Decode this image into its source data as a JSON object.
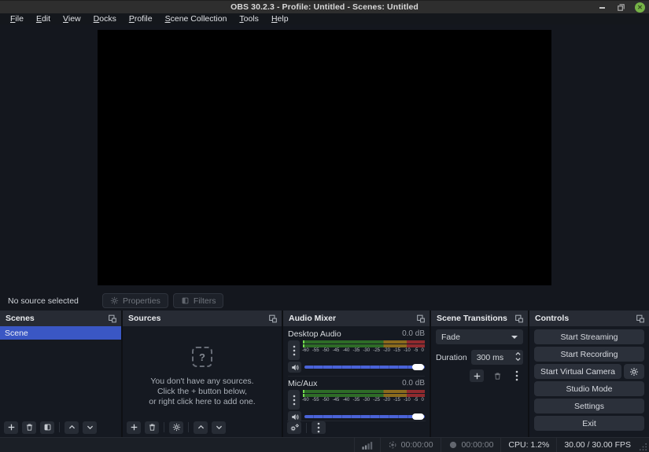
{
  "titlebar": {
    "title": "OBS 30.2.3 - Profile: Untitled - Scenes: Untitled"
  },
  "menubar": {
    "items": [
      "File",
      "Edit",
      "View",
      "Docks",
      "Profile",
      "Scene Collection",
      "Tools",
      "Help"
    ]
  },
  "source_toolbar": {
    "status": "No source selected",
    "properties": "Properties",
    "filters": "Filters"
  },
  "scenes": {
    "title": "Scenes",
    "items": [
      {
        "label": "Scene"
      }
    ]
  },
  "sources": {
    "title": "Sources",
    "empty_icon": "?",
    "empty_lines": [
      "You don't have any sources.",
      "Click the + button below,",
      "or right click here to add one."
    ]
  },
  "audio_mixer": {
    "title": "Audio Mixer",
    "channels": [
      {
        "name": "Desktop Audio",
        "level": "0.0 dB"
      },
      {
        "name": "Mic/Aux",
        "level": "0.0 dB"
      }
    ],
    "ticks": [
      "-60",
      "-55",
      "-50",
      "-45",
      "-40",
      "-35",
      "-30",
      "-25",
      "-20",
      "-15",
      "-10",
      "-5",
      "0"
    ]
  },
  "transitions": {
    "title": "Scene Transitions",
    "selected": "Fade",
    "duration_label": "Duration",
    "duration_value": "300 ms"
  },
  "controls": {
    "title": "Controls",
    "start_streaming": "Start Streaming",
    "start_recording": "Start Recording",
    "start_virtual_camera": "Start Virtual Camera",
    "studio_mode": "Studio Mode",
    "settings": "Settings",
    "exit": "Exit"
  },
  "statusbar": {
    "stream_time": "00:00:00",
    "record_time": "00:00:00",
    "cpu": "CPU: 1.2%",
    "fps": "30.00 / 30.00 FPS"
  },
  "colors": {
    "selection_blue": "#3a57c4",
    "slider_blue": "#4a63d8",
    "close_button_green": "#76b347",
    "meter_green": "#2e6b27",
    "meter_yellow": "#8a6a1d",
    "meter_red": "#8f2a2e",
    "meter_peak_green": "#71d94e"
  }
}
